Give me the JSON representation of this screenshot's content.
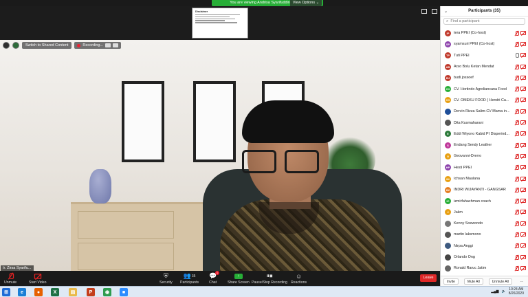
{
  "share_bar": {
    "text": "You are viewing Andrisa Syarifuddin's screen",
    "view_options": "View Options ⌄"
  },
  "shared_doc": {
    "title": "Disclaimer",
    "lines": [
      "Materi yang saya sampaikan hanya merupakan pandangan pribadi",
      "Kesamaan data/informasi yang ada di materi",
      "tidak mencerminkan kebijakan instansi"
    ]
  },
  "video_overlay": {
    "switch_label": "Switch to Shared Content",
    "recording_label": "Recording...",
    "speaker_name": "Ir. Zirsa Syarifu..."
  },
  "toolbar": {
    "unmute": "Unmute",
    "start_video": "Start Video",
    "security": "Security",
    "participants": "Participants",
    "participants_count": "35",
    "chat": "Chat",
    "chat_badge": "1",
    "share_screen": "Share Screen",
    "pause_recording": "Pause/Stop Recording",
    "reactions": "Reactions",
    "leave": "Leave"
  },
  "panel": {
    "title": "Participants (35)",
    "search_placeholder": "Find a participant",
    "participants": [
      {
        "initials": "IP",
        "color": "#c0392b",
        "name": "tera PPEI (Co-host)",
        "mic": "off",
        "cam": "off"
      },
      {
        "initials": "SP",
        "color": "#8e44ad",
        "name": "syamsuri PPEI (Co-host)",
        "mic": "off",
        "cam": "off"
      },
      {
        "initials": "TP",
        "color": "#c0392b",
        "name": "Tuti PPEI",
        "mic": "on",
        "cam": "off"
      },
      {
        "initials": "AB",
        "color": "#c0392b",
        "name": "Arso Bolu Ketan Mendat",
        "mic": "off",
        "cam": "off"
      },
      {
        "initials": "BJ",
        "color": "#c0392b",
        "name": "budi jossoef",
        "mic": "off",
        "cam": "off"
      },
      {
        "initials": "CH",
        "color": "#27ae37",
        "name": "CV. Hortindo Agroliancana Food",
        "mic": "off",
        "cam": "off"
      },
      {
        "initials": "CO",
        "color": "#e8a013",
        "name": "CV. OMEKU FOOD ( Hendri Ca...",
        "mic": "off",
        "cam": "off"
      },
      {
        "initials": "",
        "color": "#1f4f9a",
        "name": "Dervin Rizza Salim-CV Mama in...",
        "mic": "off",
        "cam": "off"
      },
      {
        "initials": "",
        "color": "#555555",
        "name": "Dita Kusmaharani",
        "mic": "off",
        "cam": "off"
      },
      {
        "initials": "E",
        "color": "#2c7a3a",
        "name": "Eddi Wiyono Kabid PI Disperind...",
        "mic": "off",
        "cam": "off"
      },
      {
        "initials": "S",
        "color": "#c0399b",
        "name": "Endang Sendy Leather",
        "mic": "off",
        "cam": "off"
      },
      {
        "initials": "G",
        "color": "#e8a013",
        "name": "Geovanni-Drerro",
        "mic": "off",
        "cam": "off"
      },
      {
        "initials": "HP",
        "color": "#8e44ad",
        "name": "Hesti PPEI",
        "mic": "off",
        "cam": "off"
      },
      {
        "initials": "IM",
        "color": "#e8a013",
        "name": "Ichsan Maulana",
        "mic": "off",
        "cam": "off"
      },
      {
        "initials": "IW",
        "color": "#e67e22",
        "name": "INDRI WIJAYANTI - GANGSAR",
        "mic": "off",
        "cam": "off"
      },
      {
        "initials": "IC",
        "color": "#27ae37",
        "name": "izmirfahachman coach",
        "mic": "off",
        "cam": "off"
      },
      {
        "initials": "J",
        "color": "#e8a013",
        "name": "Jakm",
        "mic": "off",
        "cam": "off"
      },
      {
        "initials": "",
        "color": "#777777",
        "name": "Kenny Soewondo",
        "mic": "off",
        "cam": "off"
      },
      {
        "initials": "",
        "color": "#555555",
        "name": "martin laksmono",
        "mic": "off",
        "cam": "off"
      },
      {
        "initials": "",
        "color": "#3d5a80",
        "name": "Nirpa Anggi",
        "mic": "off",
        "cam": "off"
      },
      {
        "initials": "",
        "color": "#444444",
        "name": "Orlando Ong",
        "mic": "off",
        "cam": "off"
      },
      {
        "initials": "",
        "color": "#666666",
        "name": "Ronald Raruc Jatim",
        "mic": "off",
        "cam": "off"
      }
    ],
    "invite": "Invite",
    "mute_all": "Mute All",
    "unmute_all": "Unmute All",
    "more": "..."
  },
  "taskbar": {
    "apps": [
      {
        "name": "windows-start-icon",
        "color": "#1e6bd6",
        "glyph": "⊞"
      },
      {
        "name": "ie-icon",
        "color": "#1b7fd6",
        "glyph": "e"
      },
      {
        "name": "firefox-icon",
        "color": "#e66000",
        "glyph": "●"
      },
      {
        "name": "excel-icon",
        "color": "#1e7145",
        "glyph": "X"
      },
      {
        "name": "explorer-icon",
        "color": "#e9b949",
        "glyph": "▤"
      },
      {
        "name": "powerpoint-icon",
        "color": "#c43e1c",
        "glyph": "P"
      },
      {
        "name": "chrome-icon",
        "color": "#2e9c4f",
        "glyph": "◉"
      },
      {
        "name": "zoom-icon",
        "color": "#2d8cff",
        "glyph": "■"
      }
    ],
    "time": "10:24 AM",
    "date": "8/26/2020"
  }
}
